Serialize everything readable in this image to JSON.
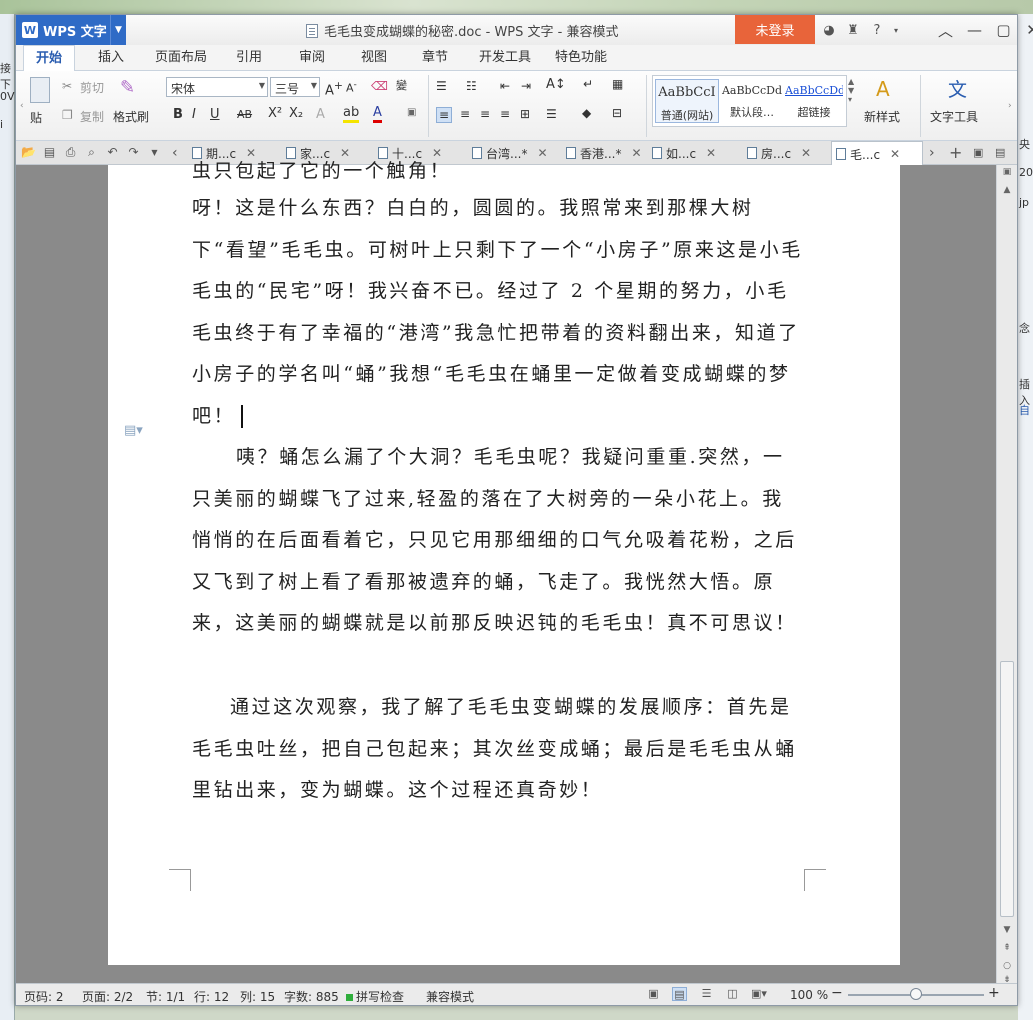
{
  "app": {
    "name": "WPS 文字",
    "logo": "W",
    "title": "毛毛虫变成蝴蝶的秘密.doc - WPS 文字 - 兼容模式",
    "login": "未登录"
  },
  "menu": [
    "开始",
    "插入",
    "页面布局",
    "引用",
    "审阅",
    "视图",
    "章节",
    "开发工具",
    "特色功能"
  ],
  "ribbon": {
    "paste": "贴",
    "cut": "剪切",
    "copy": "复制",
    "format_painter": "格式刷",
    "font_name": "宋体",
    "font_size": "三号",
    "styles": [
      {
        "sample": "AaBbCcI",
        "label": "普通(网站)"
      },
      {
        "sample": "AaBbCcDd",
        "label": "默认段…"
      },
      {
        "sample": "AaBbCcDd",
        "label": "超链接"
      }
    ],
    "new_style": "新样式",
    "text_tools": "文字工具"
  },
  "tabs": [
    "期...c",
    "家...c",
    "十...c",
    "台湾...*",
    "香港...*",
    "如...c",
    "房...c",
    "毛...c"
  ],
  "document": {
    "paragraphs": [
      "虫只包起了它的一个触角！",
      "呀！这是什么东西？白白的，圆圆的。我照常来到那棵大树下“看望”毛毛虫。可树叶上只剩下了一个“小房子”原来这是小毛毛虫的“民宅”呀！我兴奋不已。经过了 2 个星期的努力，小毛毛虫终于有了幸福的“港湾”我急忙把带着的资料翻出来，知道了小房子的学名叫“蛹”我想“毛毛虫在蛹里一定做着变成蝴蝶的梦吧！",
      "咦？蛹怎么漏了个大洞？毛毛虫呢？我疑问重重.突然，一只美丽的蝴蝶飞了过来,轻盈的落在了大树旁的一朵小花上。我悄悄的在后面看着它，只见它用那细细的口气允吸着花粉，之后又飞到了树上看了看那被遗弃的蛹，飞走了。我恍然大悟。原来，这美丽的蝴蝶就是以前那反映迟钝的毛毛虫！真不可思议！",
      "通过这次观察，我了解了毛毛虫变蝴蝶的发展顺序：首先是毛毛虫吐丝，把自己包起来；其次丝变成蛹；最后是毛毛虫从蛹里钻出来，变为蝴蝶。这个过程还真奇妙！"
    ]
  },
  "status": {
    "page_code": "页码: 2",
    "pages": "页面: 2/2",
    "section": "节: 1/1",
    "line": "行: 12",
    "col": "列: 15",
    "words": "字数: 885",
    "spell": "拼写检查",
    "mode": "兼容模式",
    "zoom": "100 %",
    "zoom_level": 0.5
  },
  "bg": {
    "left": [
      "接下",
      "0V",
      "i"
    ],
    "right": [
      "央",
      "20",
      "jp",
      "念",
      "插入",
      "自"
    ]
  }
}
